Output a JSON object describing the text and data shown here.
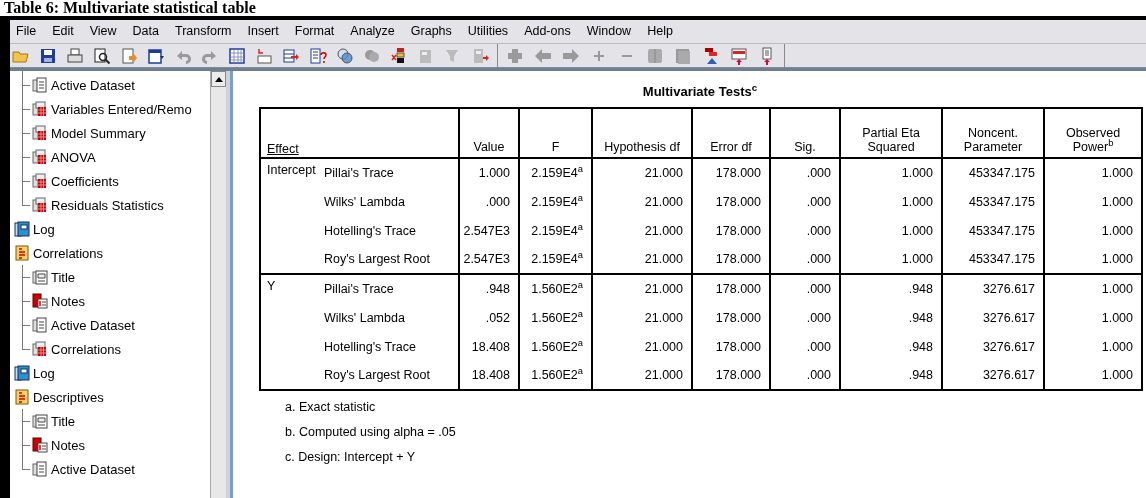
{
  "caption": "Table 6: Multivariate statistical table",
  "menu": [
    "File",
    "Edit",
    "View",
    "Data",
    "Transform",
    "Insert",
    "Format",
    "Analyze",
    "Graphs",
    "Utilities",
    "Add-ons",
    "Window",
    "Help"
  ],
  "tree": {
    "continued_children": [
      {
        "label": "Active Dataset",
        "kind": "text"
      },
      {
        "label": "Variables Entered/Remo",
        "kind": "table"
      },
      {
        "label": "Model Summary",
        "kind": "table"
      },
      {
        "label": "ANOVA",
        "kind": "table"
      },
      {
        "label": "Coefficients",
        "kind": "table"
      },
      {
        "label": "Residuals Statistics",
        "kind": "table"
      }
    ],
    "items": [
      {
        "label": "Log",
        "kind": "log"
      },
      {
        "label": "Correlations",
        "kind": "heading",
        "children": [
          {
            "label": "Title",
            "kind": "title"
          },
          {
            "label": "Notes",
            "kind": "notes"
          },
          {
            "label": "Active Dataset",
            "kind": "text"
          },
          {
            "label": "Correlations",
            "kind": "table"
          }
        ]
      },
      {
        "label": "Log",
        "kind": "log"
      },
      {
        "label": "Descriptives",
        "kind": "heading",
        "children": [
          {
            "label": "Title",
            "kind": "title"
          },
          {
            "label": "Notes",
            "kind": "notes"
          },
          {
            "label": "Active Dataset",
            "kind": "text"
          }
        ]
      }
    ]
  },
  "table": {
    "title": "Multivariate Tests$^{c}$",
    "columns": [
      "Effect",
      "Value",
      "F",
      "Hypothesis df",
      "Error df",
      "Sig.",
      "Partial Eta Squared",
      "Noncent. Parameter",
      "Observed Power$^{b}$"
    ],
    "groups": [
      {
        "effect": "Intercept",
        "rows": [
          {
            "test": "Pillai's Trace",
            "cells": [
              "1.000",
              "2.159E4$^{a}$",
              "21.000",
              "178.000",
              ".000",
              "1.000",
              "453347.175",
              "1.000"
            ]
          },
          {
            "test": "Wilks' Lambda",
            "cells": [
              ".000",
              "2.159E4$^{a}$",
              "21.000",
              "178.000",
              ".000",
              "1.000",
              "453347.175",
              "1.000"
            ]
          },
          {
            "test": "Hotelling's Trace",
            "cells": [
              "2.547E3",
              "2.159E4$^{a}$",
              "21.000",
              "178.000",
              ".000",
              "1.000",
              "453347.175",
              "1.000"
            ]
          },
          {
            "test": "Roy's Largest Root",
            "cells": [
              "2.547E3",
              "2.159E4$^{a}$",
              "21.000",
              "178.000",
              ".000",
              "1.000",
              "453347.175",
              "1.000"
            ]
          }
        ]
      },
      {
        "effect": "Y",
        "rows": [
          {
            "test": "Pillai's Trace",
            "cells": [
              ".948",
              "1.560E2$^{a}$",
              "21.000",
              "178.000",
              ".000",
              ".948",
              "3276.617",
              "1.000"
            ]
          },
          {
            "test": "Wilks' Lambda",
            "cells": [
              ".052",
              "1.560E2$^{a}$",
              "21.000",
              "178.000",
              ".000",
              ".948",
              "3276.617",
              "1.000"
            ]
          },
          {
            "test": "Hotelling's Trace",
            "cells": [
              "18.408",
              "1.560E2$^{a}$",
              "21.000",
              "178.000",
              ".000",
              ".948",
              "3276.617",
              "1.000"
            ]
          },
          {
            "test": "Roy's Largest Root",
            "cells": [
              "18.408",
              "1.560E2$^{a}$",
              "21.000",
              "178.000",
              ".000",
              ".948",
              "3276.617",
              "1.000"
            ]
          }
        ]
      }
    ],
    "footnotes": [
      "a. Exact statistic",
      "b. Computed using alpha = .05",
      "c. Design: Intercept + Y"
    ]
  }
}
